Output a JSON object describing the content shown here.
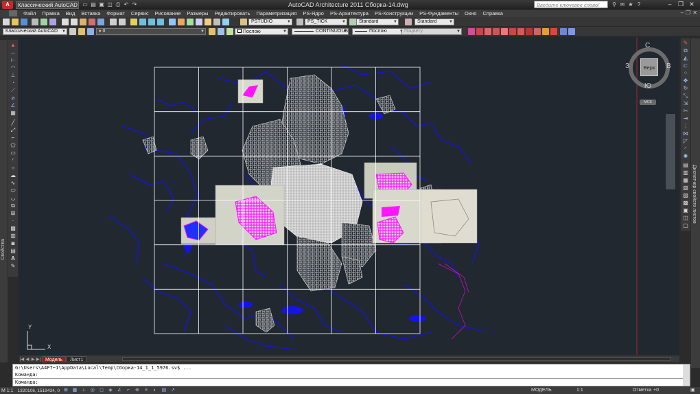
{
  "title_bar": {
    "app_icon": "A",
    "workspace": "Классический AutoCAD",
    "title": "AutoCAD Architecture 2011    Сборка-14.dwg",
    "search_placeholder": "Введите ключевое слово/фразу",
    "window_controls": [
      "–",
      "❐",
      "✕"
    ]
  },
  "menu_bar": {
    "items": [
      "Файл",
      "Правка",
      "Вид",
      "Вставка",
      "Формат",
      "Сервис",
      "Рисование",
      "Размеры",
      "Редактировать",
      "Параметризация",
      "PS-Ядро",
      "PS-Архитектура",
      "PS-Конструкции",
      "PS-Фундаменты",
      "Окно",
      "Справка"
    ]
  },
  "toolbar_styles": {
    "text_style": "PSTUDIO",
    "dim_style": "PS_TICK",
    "table_style": "Standard",
    "mleader_style": "Standard"
  },
  "toolbar_props": {
    "workspace": "Классический AutoCAD",
    "layer": "0",
    "color": "Послою",
    "linetype": "CONTINUOUS",
    "lineweight": "Послою",
    "plotstyle": "Поцвету"
  },
  "side_panels": {
    "properties_label": "Свойства",
    "tool_palette_label": "Диспетчер свойств листов"
  },
  "viewcube": {
    "face": "Верх",
    "north": "С",
    "south": "Ю",
    "west": "З",
    "east": "В",
    "wcs": "МСК"
  },
  "ucs": {
    "x": "X",
    "y": "Y"
  },
  "layout_tabs": {
    "nav": [
      "|◀",
      "◀",
      "▶",
      "▶|"
    ],
    "tabs": [
      "Модель",
      "Лист1"
    ],
    "active": "Модель"
  },
  "command_line": {
    "history": "G:\\Users\\A4F7~1\\AppData\\Local\\Temp\\Сборка-14_1_1_5976.sv$ ...",
    "line2": "Команда:",
    "prompt": "Команда:"
  },
  "status_bar": {
    "coords": "1320106, 1519434, 0",
    "scale": "М 1:1",
    "model": "МОДЕЛЬ",
    "annotation_scale": "1:1",
    "cleanscreen": "Отметка",
    "elevation": "+0"
  },
  "colors": {
    "canvas_bg": "#212830",
    "water": "#1414e6",
    "highlight": "#ff14ff",
    "grid": "#ffffff",
    "active_tab": "#9b1a1a"
  }
}
